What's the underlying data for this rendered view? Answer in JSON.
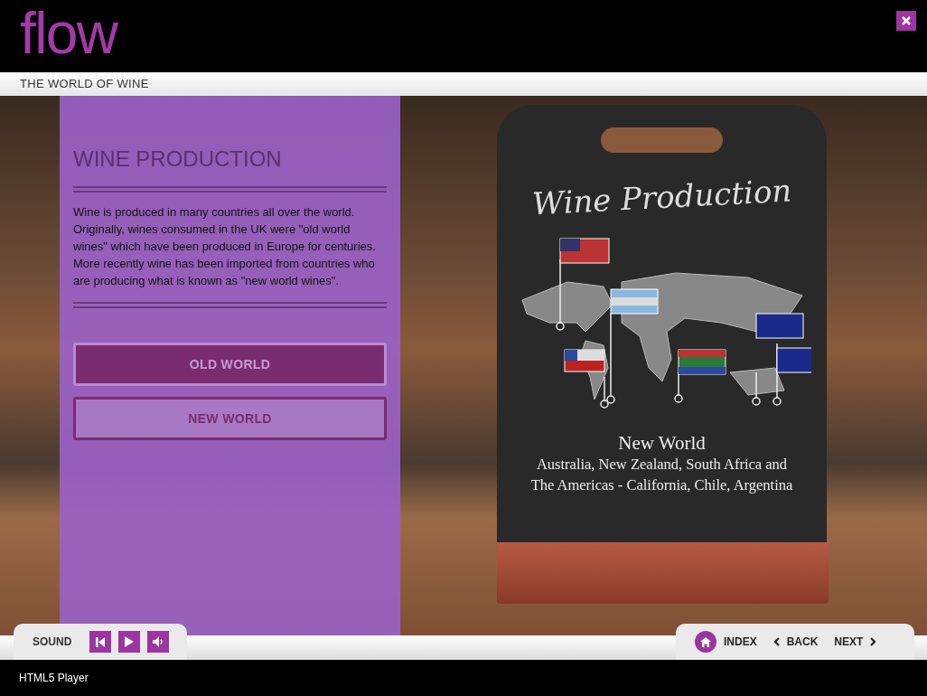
{
  "header": {
    "logo": "flow"
  },
  "course_title": "THE WORLD OF WINE",
  "panel": {
    "heading": "WINE PRODUCTION",
    "body": "Wine is produced in many countries all over the world. Originally, wines consumed in the UK were \"old world wines\" which have been produced in Europe for centuries. More recently wine has been imported from countries who are producing what is known as \"new world wines\".",
    "buttons": [
      {
        "label": "OLD WORLD",
        "selected": true
      },
      {
        "label": "NEW WORLD",
        "selected": false
      }
    ]
  },
  "chalkboard": {
    "title": "Wine Production",
    "heading": "New World",
    "lines": [
      "Australia, New Zealand, South Africa and",
      "The Americas - California, Chile, Argentina"
    ]
  },
  "player": {
    "sound_label": "SOUND",
    "nav": [
      {
        "kind": "home",
        "label": "INDEX"
      },
      {
        "kind": "back",
        "label": "BACK"
      },
      {
        "kind": "next",
        "label": "NEXT"
      }
    ]
  },
  "footer": "HTML5 Player"
}
